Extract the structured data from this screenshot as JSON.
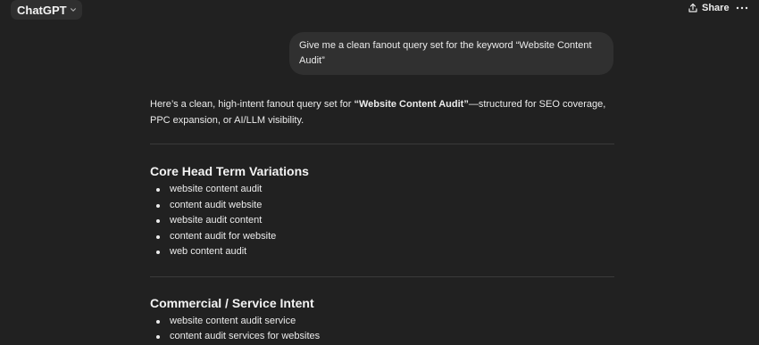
{
  "topbar": {
    "model_name": "ChatGPT",
    "share_label": "Share"
  },
  "conversation": {
    "user_message": "Give me a clean fanout query set for the keyword “Website Content Audit”",
    "response": {
      "intro_prefix": "Here’s a clean, high-intent fanout query set for ",
      "intro_keyword": "“Website Content Audit”",
      "intro_suffix": "—structured for SEO coverage, PPC expansion, or AI/LLM visibility.",
      "sections": [
        {
          "title": "Core Head Term Variations",
          "items": [
            "website content audit",
            "content audit website",
            "website audit content",
            "content audit for website",
            "web content audit"
          ]
        },
        {
          "title": "Commercial / Service Intent",
          "items": [
            "website content audit service",
            "content audit services for websites"
          ]
        }
      ]
    }
  }
}
